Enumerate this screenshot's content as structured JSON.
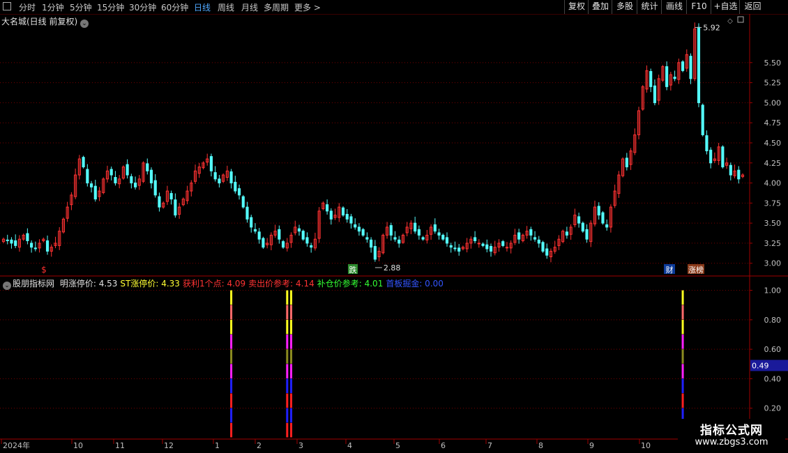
{
  "toolbar": {
    "periods": [
      "分时",
      "1分钟",
      "5分钟",
      "15分钟",
      "30分钟",
      "60分钟",
      "日线",
      "周线",
      "月线",
      "多周期",
      "更多 >"
    ],
    "active_index": 6,
    "right_buttons": [
      "复权",
      "叠加",
      "多股",
      "统计",
      "画线",
      "F10",
      "+自选",
      "返回"
    ]
  },
  "main": {
    "title": "大名城(日线 前复权)",
    "price_labels": [
      "5.50",
      "5.25",
      "5.00",
      "4.75",
      "4.50",
      "4.25",
      "4.00",
      "3.75",
      "3.50",
      "3.25",
      "3.00"
    ],
    "high_marker": "5.92",
    "low_marker": "2.88",
    "badges": {
      "s": "$",
      "die": "跌",
      "cai": "财",
      "zhangbang": "涨榜"
    }
  },
  "indicator": {
    "name": "股朋指标网",
    "items": [
      {
        "label": "明涨停价: 4.53",
        "color": "#e0e0e0"
      },
      {
        "label": "ST涨停价: 4.33",
        "color": "#ffff33"
      },
      {
        "label": "获利1个点: 4.09",
        "color": "#ff3333"
      },
      {
        "label": "卖出价参考: 4.14",
        "color": "#ff3333"
      },
      {
        "label": "补仓价参考: 4.01",
        "color": "#33ff33"
      },
      {
        "label": "首板掘金: 0.00",
        "color": "#3355ff"
      }
    ],
    "axis_labels": [
      "1.00",
      "0.80",
      "0.60",
      "0.40",
      "0.20"
    ],
    "current_value": "0.49"
  },
  "time_axis": [
    "2024年",
    "10",
    "11",
    "12",
    "1",
    "2",
    "3",
    "4",
    "5",
    "6",
    "7",
    "8",
    "9",
    "10"
  ],
  "watermark": {
    "title": "指标公式网",
    "url": "www.zbgs3.com"
  },
  "colors": {
    "up": "#ff3232",
    "down": "#54fcfc",
    "grid": "#7a0000",
    "border": "#a00000"
  },
  "chart_data": {
    "type": "candlestick",
    "price_ylim": [
      2.85,
      5.95
    ],
    "closes": [
      3.3,
      3.28,
      3.25,
      3.22,
      3.3,
      3.35,
      3.28,
      3.2,
      3.18,
      3.25,
      3.3,
      3.15,
      3.2,
      3.25,
      3.4,
      3.55,
      3.7,
      3.85,
      4.1,
      4.3,
      4.2,
      4.0,
      3.95,
      3.8,
      3.9,
      4.05,
      4.15,
      4.1,
      4.0,
      4.05,
      4.2,
      4.1,
      4.0,
      3.95,
      4.05,
      4.25,
      4.15,
      4.0,
      3.85,
      3.7,
      3.75,
      3.9,
      3.8,
      3.6,
      3.7,
      3.8,
      3.9,
      4.0,
      4.15,
      4.2,
      4.25,
      4.3,
      4.15,
      4.05,
      4.0,
      4.1,
      4.15,
      4.0,
      3.9,
      3.85,
      3.7,
      3.55,
      3.45,
      3.4,
      3.3,
      3.2,
      3.25,
      3.35,
      3.4,
      3.3,
      3.2,
      3.25,
      3.35,
      3.45,
      3.4,
      3.3,
      3.25,
      3.2,
      3.3,
      3.65,
      3.75,
      3.65,
      3.55,
      3.6,
      3.7,
      3.6,
      3.55,
      3.5,
      3.45,
      3.4,
      3.35,
      3.3,
      3.2,
      3.05,
      3.15,
      3.35,
      3.45,
      3.35,
      3.3,
      3.25,
      3.35,
      3.45,
      3.5,
      3.4,
      3.35,
      3.3,
      3.35,
      3.45,
      3.4,
      3.35,
      3.3,
      3.25,
      3.2,
      3.18,
      3.15,
      3.2,
      3.25,
      3.3,
      3.28,
      3.25,
      3.22,
      3.18,
      3.15,
      3.2,
      3.25,
      3.22,
      3.2,
      3.25,
      3.35,
      3.3,
      3.35,
      3.4,
      3.35,
      3.3,
      3.25,
      3.15,
      3.1,
      3.15,
      3.2,
      3.3,
      3.4,
      3.35,
      3.45,
      3.6,
      3.5,
      3.4,
      3.3,
      3.5,
      3.7,
      3.6,
      3.5,
      3.45,
      3.7,
      3.9,
      4.1,
      4.3,
      4.2,
      4.4,
      4.6,
      4.9,
      5.2,
      5.4,
      5.2,
      5.0,
      5.3,
      5.45,
      5.2,
      5.35,
      5.3,
      5.5,
      5.4,
      5.6,
      5.3,
      5.92,
      5.0,
      4.6,
      4.4,
      4.25,
      4.3,
      4.45,
      4.2,
      4.25,
      4.1,
      4.15,
      4.05,
      4.1
    ],
    "indicator_signals": [
      {
        "bar": 57,
        "value": 1.0
      },
      {
        "bar": 71,
        "value": 1.0
      },
      {
        "bar": 72,
        "value": 1.0
      },
      {
        "bar": 170,
        "value": 1.0
      }
    ],
    "indicator_ylim": [
      0.0,
      1.05
    ],
    "stack_colors": [
      "#ff2020",
      "#2020ff",
      "#ff2020",
      "#2020ff",
      "#ff20ff",
      "#8b8b20",
      "#ff20ff",
      "#ffff20",
      "#ff6a6a",
      "#ffff20"
    ]
  }
}
